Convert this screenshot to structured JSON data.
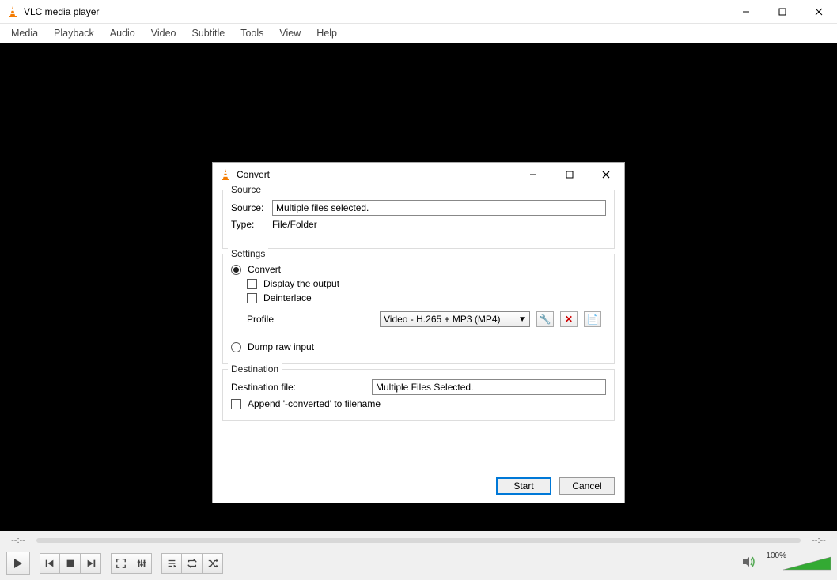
{
  "main": {
    "title": "VLC media player",
    "menus": [
      "Media",
      "Playback",
      "Audio",
      "Video",
      "Subtitle",
      "Tools",
      "View",
      "Help"
    ],
    "time_elapsed": "--:--",
    "time_total": "--:--",
    "volume_pct": "100%"
  },
  "dialog": {
    "title": "Convert",
    "source": {
      "legend": "Source",
      "source_label": "Source:",
      "source_value": "Multiple files selected.",
      "type_label": "Type:",
      "type_value": "File/Folder"
    },
    "settings": {
      "legend": "Settings",
      "convert_label": "Convert",
      "display_label": "Display the output",
      "deinterlace_label": "Deinterlace",
      "profile_label": "Profile",
      "profile_value": "Video - H.265 + MP3 (MP4)",
      "dump_label": "Dump raw input"
    },
    "destination": {
      "legend": "Destination",
      "file_label": "Destination file:",
      "file_value": "Multiple Files Selected.",
      "append_label": "Append '-converted' to filename"
    },
    "buttons": {
      "start": "Start",
      "cancel": "Cancel"
    }
  }
}
